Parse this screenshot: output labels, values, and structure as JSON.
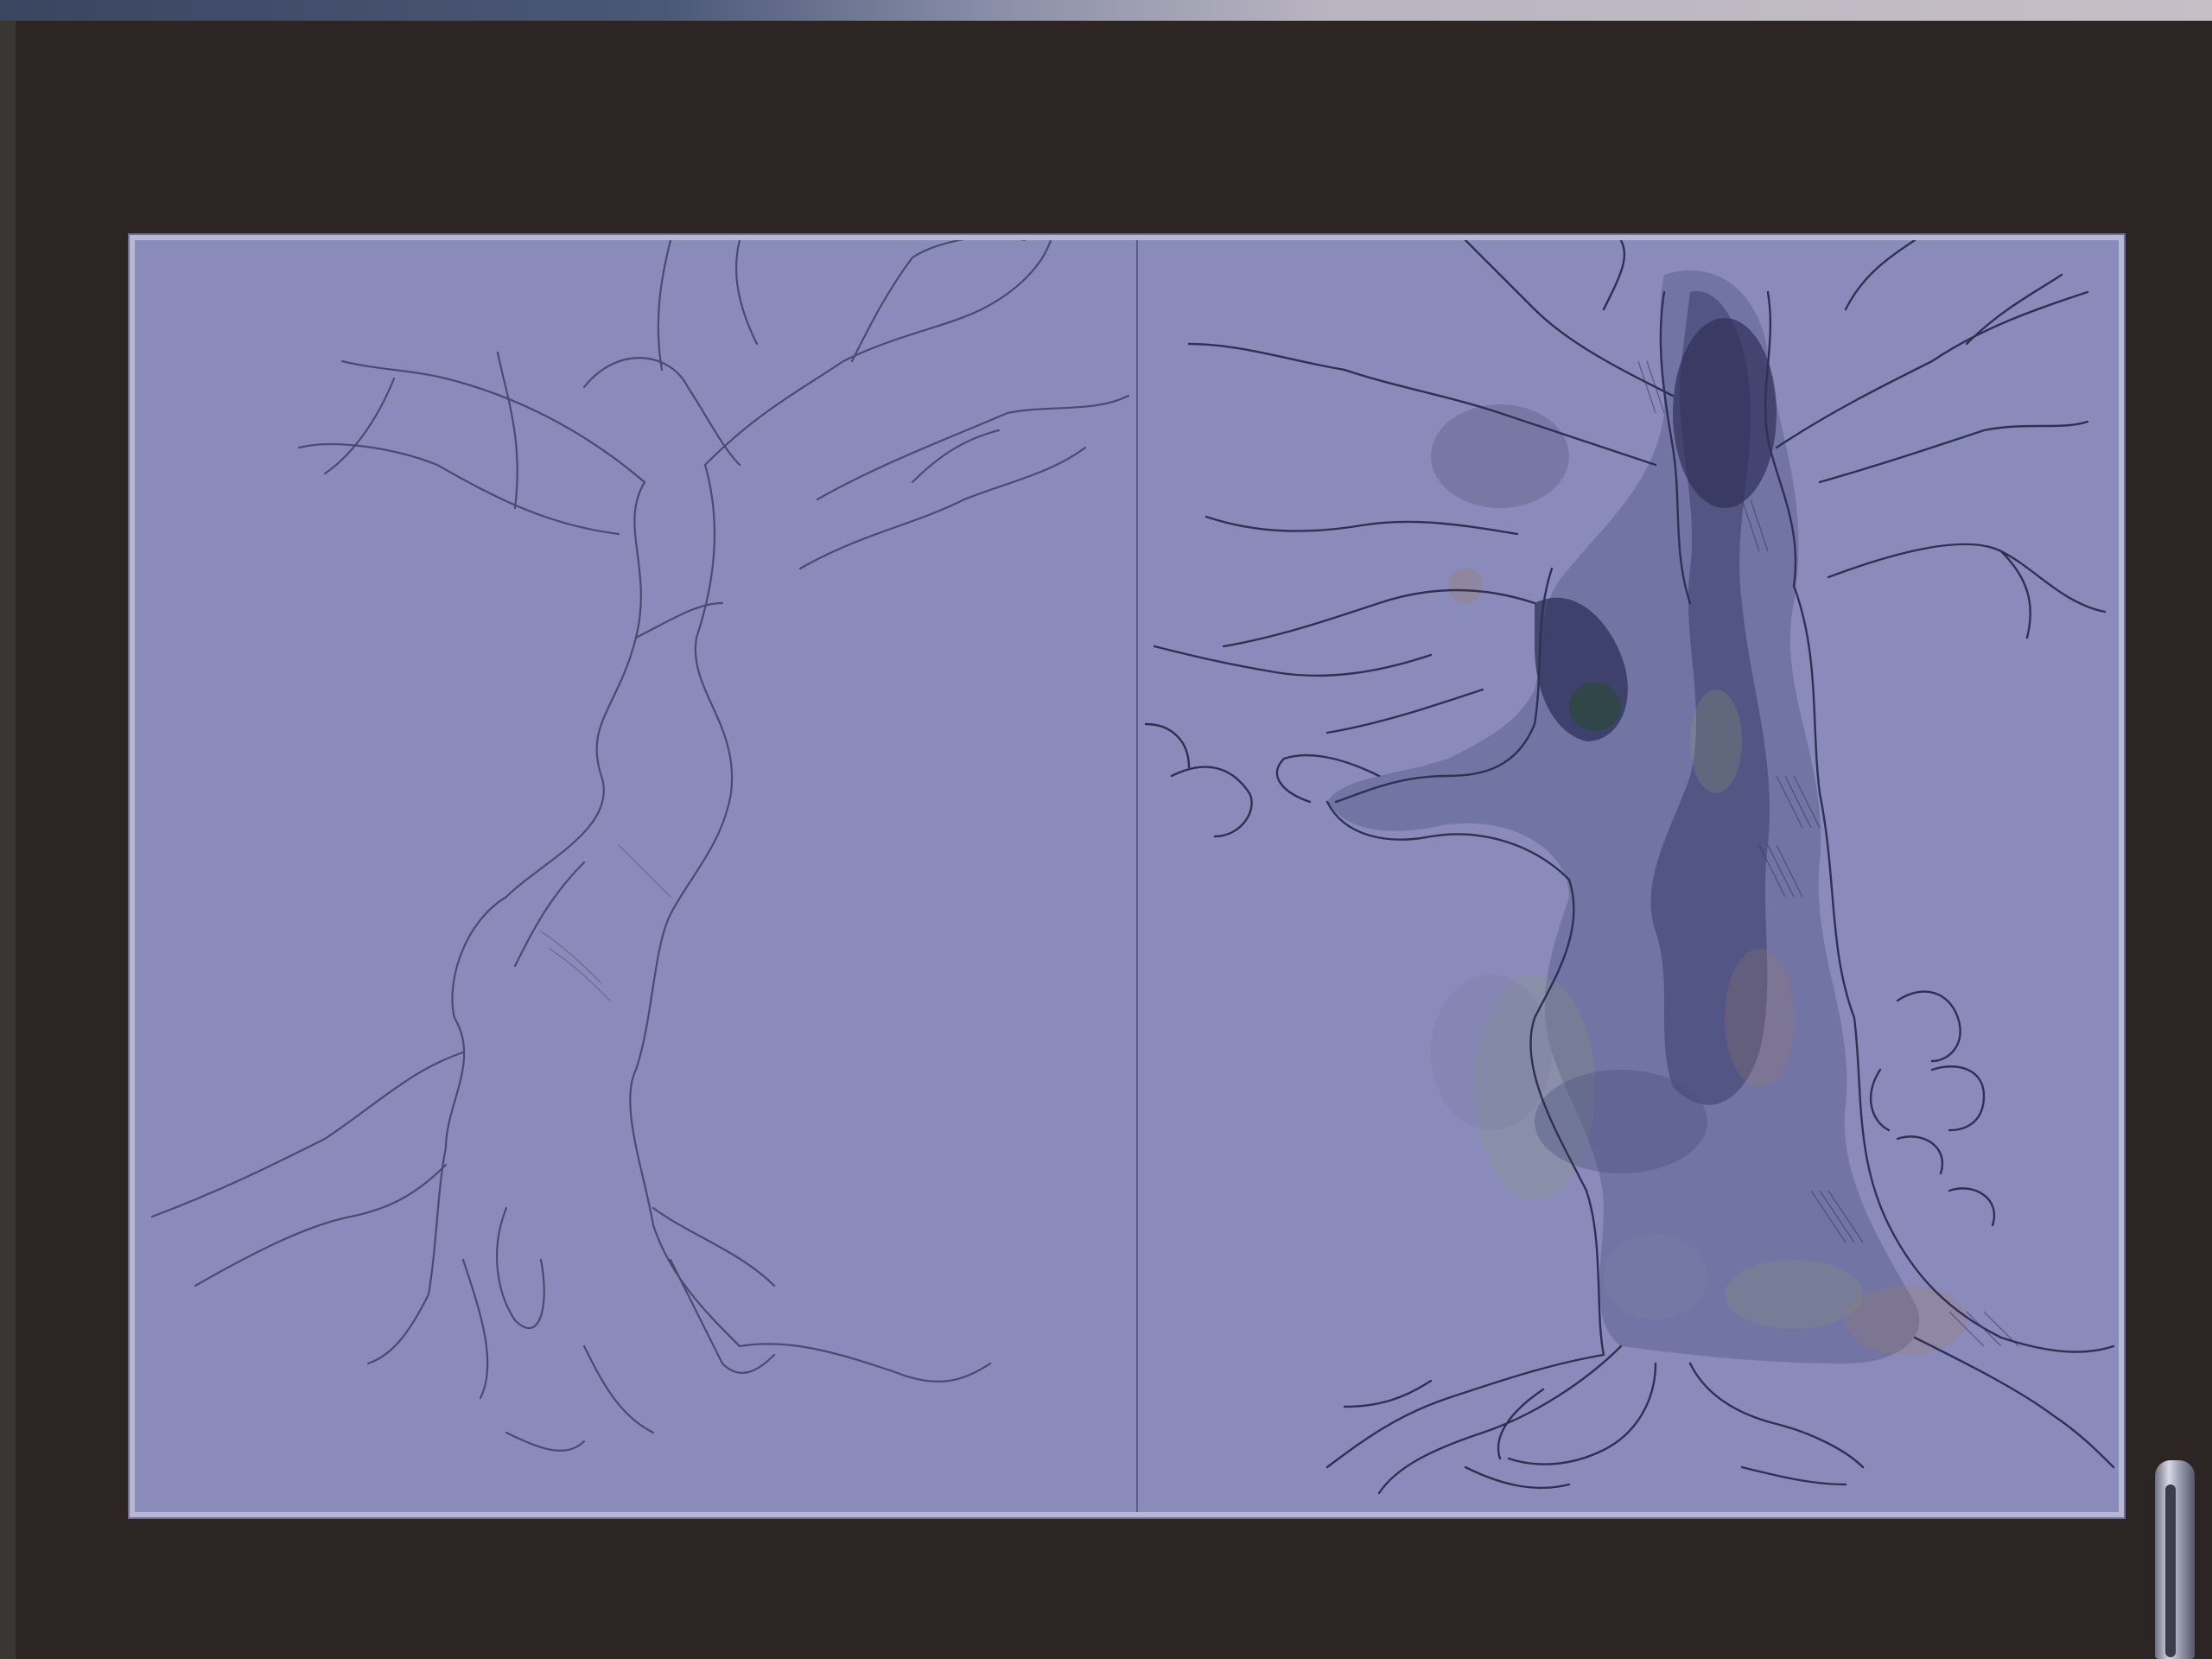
{
  "scene": {
    "description_label": "",
    "colors": {
      "wall": "#2d2524",
      "paper": "#8a8bba",
      "paper_border": "#b7b8d6",
      "pencil": "#3a3b58",
      "trunk_shade": "#565a82",
      "moss": "#8aa06a",
      "rust": "#a07a60",
      "handle": "#c8c9d6"
    }
  }
}
